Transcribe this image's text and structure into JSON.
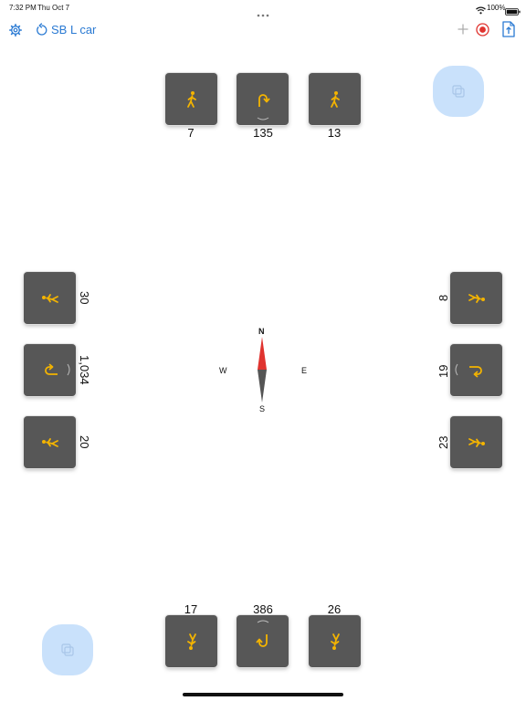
{
  "status_bar": {
    "time": "7:32 PM",
    "date": "Thu Oct 7",
    "battery": "100%"
  },
  "toolbar": {
    "session_title": "SB L car"
  },
  "compass": {
    "north": "N",
    "south": "S",
    "east": "E",
    "west": "W"
  },
  "north_approach": {
    "left_label": "7",
    "center_label": "135",
    "right_label": "13"
  },
  "south_approach": {
    "left_label": "17",
    "center_label": "386",
    "right_label": "26"
  },
  "west_approach": {
    "top_label": "30",
    "middle_label": "1,034",
    "bottom_label": "20"
  },
  "east_approach": {
    "top_label": "8",
    "middle_label": "19",
    "bottom_label": "23"
  },
  "colors": {
    "accent": "#2a7ad3",
    "tile": "#575757",
    "movement_icon": "#f4b400",
    "record": "#e0332f",
    "bubble": "#c9e1fb"
  }
}
